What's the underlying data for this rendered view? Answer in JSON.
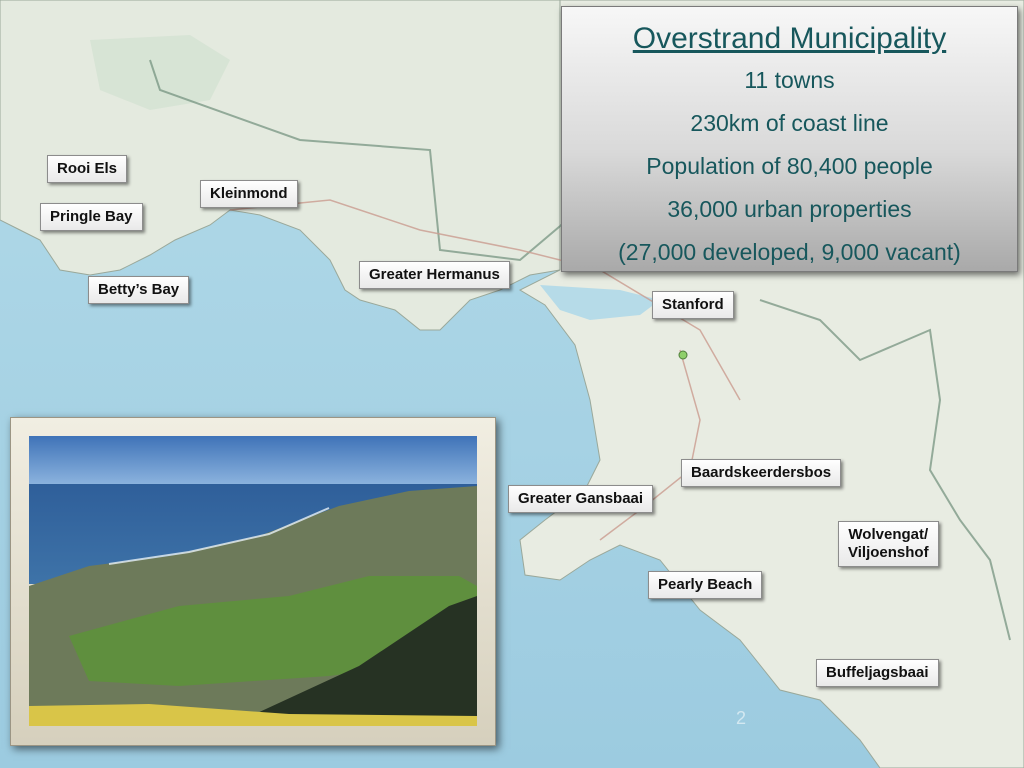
{
  "info_panel": {
    "title": "Overstrand Municipality",
    "lines": [
      "11 towns",
      "230km of coast line",
      "Population of 80,400 people",
      "36,000 urban properties",
      "(27,000 developed, 9,000 vacant)"
    ]
  },
  "towns": [
    "Rooi Els",
    "Kleinmond",
    "Pringle Bay",
    "Betty’s Bay",
    "Greater Hermanus",
    "Stanford",
    "Baardskeerdersbos",
    "Greater Gansbaai",
    "Wolvengat/\nViljoenshof",
    "Pearly Beach",
    "Buffeljagsbaai"
  ],
  "slide_number": "2",
  "colors": {
    "sea": "#a9d3e4",
    "land": "#e6ebdf",
    "panel_text": "#17575c"
  }
}
